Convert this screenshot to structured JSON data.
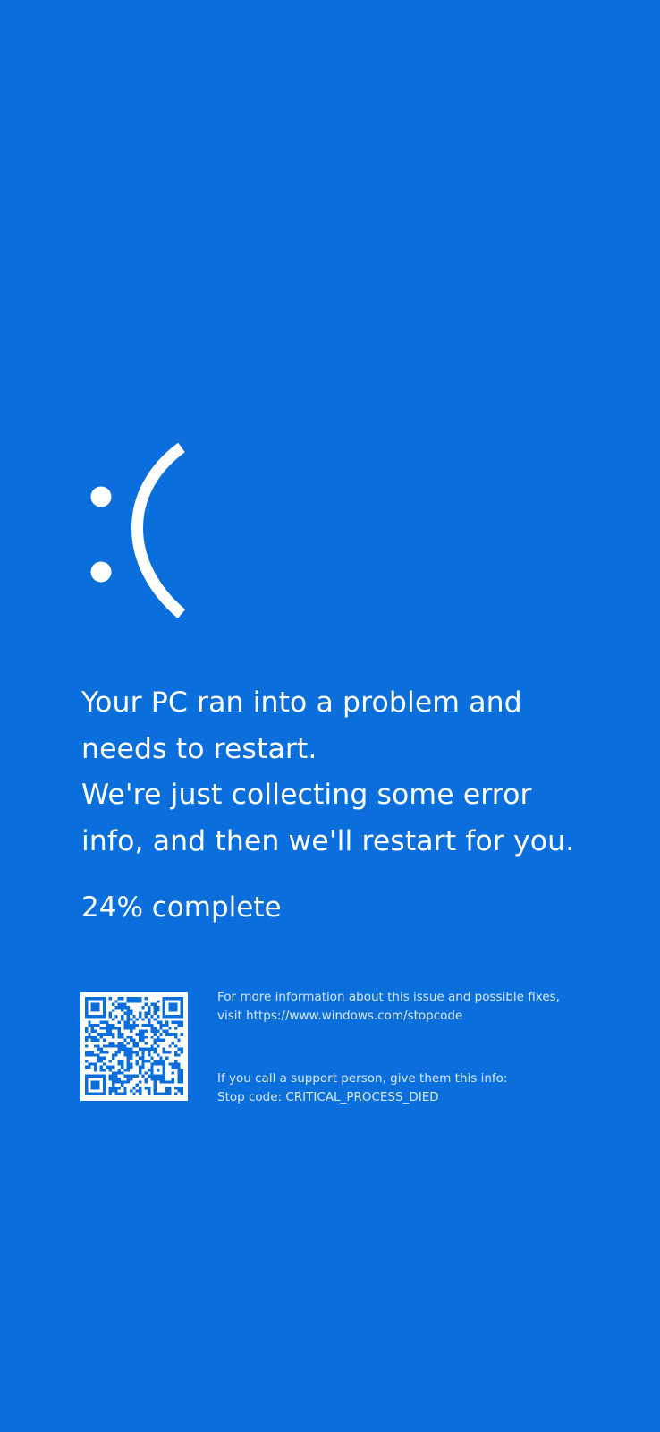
{
  "screen": {
    "background_color": "#0a6fdd",
    "text_color": "#ffffff",
    "secondary_text_color": "#d7e7fa"
  },
  "emoticon": ":(",
  "message": {
    "line_1": "Your PC ran into a problem and",
    "line_2": "needs to restart.",
    "line_3": "We're just collecting some error",
    "line_4": "info, and then we'll restart for you."
  },
  "progress": {
    "text": "24% complete",
    "value": 24
  },
  "qr_code": {
    "icon": "qr-code-icon"
  },
  "more_info": {
    "line_1": "For more information about this issue and possible fixes,",
    "line_2": "visit https://www.windows.com/stopcode"
  },
  "support": {
    "line_1": "If you call a support person, give them this info:",
    "line_2": "Stop code: CRITICAL_PROCESS_DIED"
  }
}
